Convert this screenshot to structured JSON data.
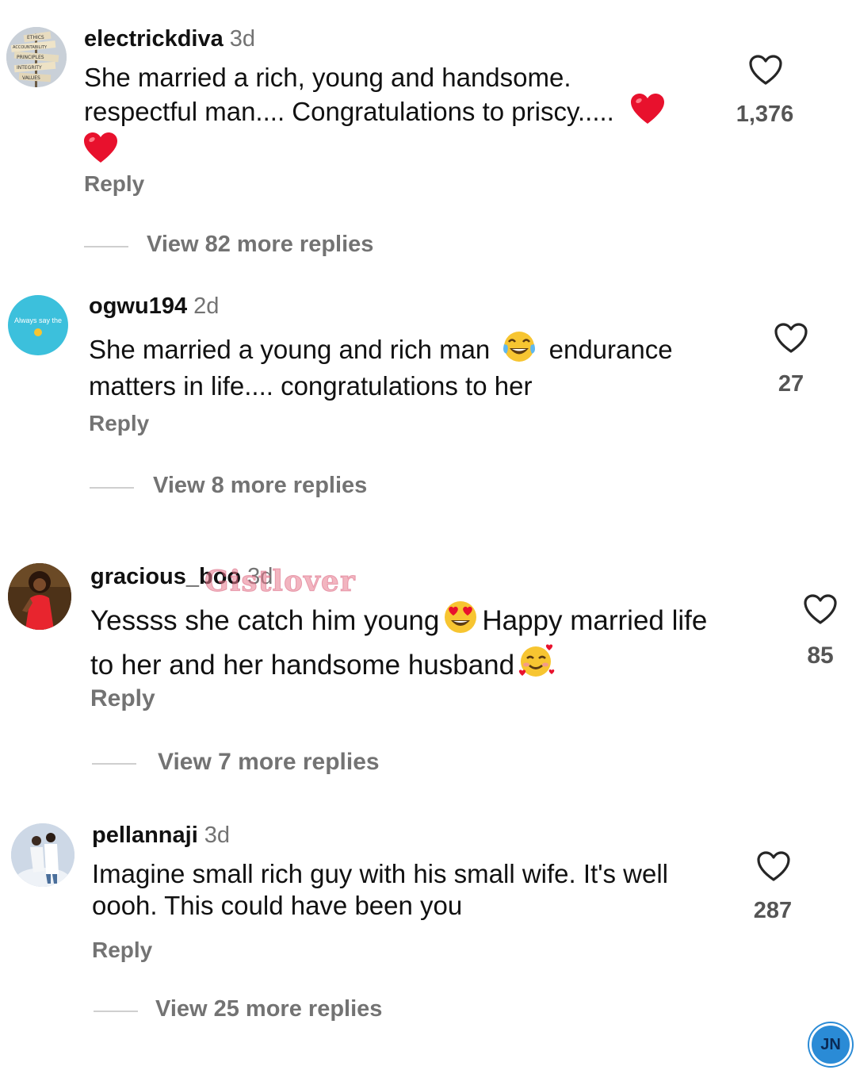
{
  "comments": [
    {
      "username": "electrickdiva",
      "time": "3d",
      "text_line1": "She married a rich, young and handsome.",
      "text_line2": "respectful man.... Congratulations to priscy.....",
      "likes": "1,376",
      "reply_label": "Reply",
      "view_more": "View 82 more replies",
      "avatar_sign": [
        "ETHICS",
        "ACCOUNTABILITY",
        "PRINCIPLES",
        "INTEGRITY",
        "VALUES"
      ]
    },
    {
      "username": "ogwu194",
      "time": "2d",
      "text_part1": "She married a young and rich man",
      "text_part2": "endurance",
      "text_line2": "matters in life.... congratulations to her",
      "likes": "27",
      "reply_label": "Reply",
      "view_more": "View 8 more replies",
      "avatar_text": "Always say the"
    },
    {
      "username": "gracious_boo",
      "time": "3d",
      "text_part1": "Yessss she catch him young",
      "text_part2": "Happy married life",
      "text_line2": "to her and her handsome husband",
      "likes": "85",
      "reply_label": "Reply",
      "view_more": "View 7 more replies"
    },
    {
      "username": "pellannaji",
      "time": "3d",
      "text_line1": "Imagine small rich guy with his small wife. It's well",
      "text_line2": "oooh. This could have been you",
      "likes": "287",
      "reply_label": "Reply",
      "view_more": "View 25 more replies"
    }
  ],
  "watermark": "Gistlover",
  "logo": "JN",
  "colors": {
    "secondary_text": "#737373",
    "heart_emoji": "#e8112d",
    "avatar2_bg": "#3cc0dc"
  }
}
